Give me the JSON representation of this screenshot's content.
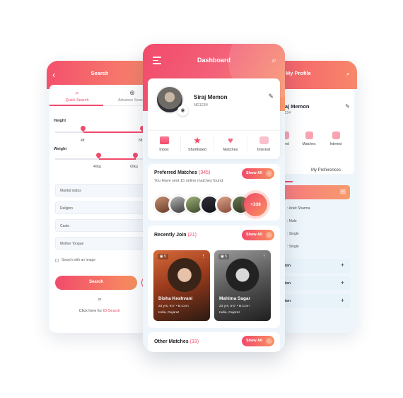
{
  "search_screen": {
    "title": "Search",
    "back_icon": "chevron-left-icon",
    "tabs": [
      {
        "label": "Quick Search",
        "icon": "search-icon",
        "active": true
      },
      {
        "label": "Advance Search",
        "icon": "zoom-in-icon",
        "active": false
      }
    ],
    "height": {
      "label": "Height",
      "min_label": "4ft",
      "max_label": "5ft"
    },
    "weight": {
      "label": "Weight",
      "min_label": "40kg",
      "max_label": "60kg"
    },
    "fields": [
      "Marital status",
      "Religion",
      "Caste",
      "Mother Tongue"
    ],
    "checkbox_label": "Search with an image",
    "search_button": "Search",
    "or_text": "or",
    "click_text": "Click here for",
    "id_search_link": "ID Search",
    "accent": "#f24a6b"
  },
  "dashboard": {
    "title": "Dashboard",
    "menu_icon": "menu-icon",
    "search_icon": "search-icon",
    "profile": {
      "name": "Siraj Memon",
      "id": "NE1234"
    },
    "quick_actions": [
      "Inbox",
      "Shortlisted",
      "Matches",
      "Interest"
    ],
    "preferred": {
      "title": "Preferred Matches",
      "count": "(345)",
      "subtitle": "You Have sent 15 online matches found.",
      "more": "+338",
      "show_all": "Show All"
    },
    "recent": {
      "title": "Recently Join",
      "count": "(21)",
      "show_all": "Show All",
      "cards": [
        {
          "name": "Disha Keshvani",
          "meta": "23 yrs, 5'4\" • B.Com",
          "location": "India, Gujarat",
          "photos": "5"
        },
        {
          "name": "Mahima Sagar",
          "meta": "23 yrs, 5'4\" • B.Com",
          "location": "India, Gujarat",
          "photos": "5"
        }
      ]
    },
    "other": {
      "title": "Other Matches",
      "count": "(33)",
      "show_all": "Show All"
    }
  },
  "profile_screen": {
    "title": "My Profile",
    "name": "raj Memon",
    "id": "1234",
    "quick_actions": [
      "listed",
      "Matches",
      "Interest"
    ],
    "tab_label": "My Preferences",
    "details": [
      ": Ankit Sharma",
      ": Male",
      ": Single",
      ": Single"
    ],
    "sections": [
      "ation",
      "ation",
      "ation"
    ]
  }
}
